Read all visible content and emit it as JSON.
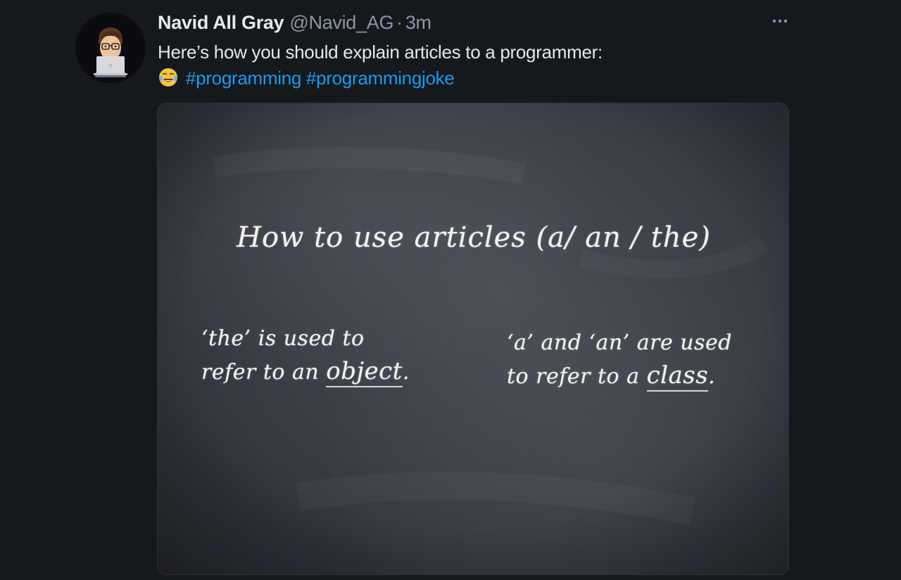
{
  "tweet": {
    "author": {
      "display_name": "Navid All Gray",
      "handle": "@Navid_AG"
    },
    "separator": "·",
    "timestamp": "3m",
    "text": {
      "line1": "Here’s how you should explain articles to a programmer:",
      "emoji": "face-with-tears-of-joy-emoji",
      "hashtags": [
        "#programming",
        "#programmingjoke"
      ]
    },
    "more_icon": "more-horizontal-icon",
    "image": {
      "title": "How to use articles (a/ an / the)",
      "left": {
        "line1": "‘the’ is used to",
        "line2_prefix": "refer to an ",
        "line2_keyword": "object",
        "line2_suffix": "."
      },
      "right": {
        "line1": "‘a’ and ‘an’ are used",
        "line2_prefix": "to refer to a ",
        "line2_keyword": "class",
        "line2_suffix": "."
      }
    }
  },
  "colors": {
    "background": "#15181c",
    "text": "#e7e9ea",
    "secondary_text": "#8b98a5",
    "hashtag": "#1d9bf0",
    "chalkboard": "#3b3f47"
  }
}
